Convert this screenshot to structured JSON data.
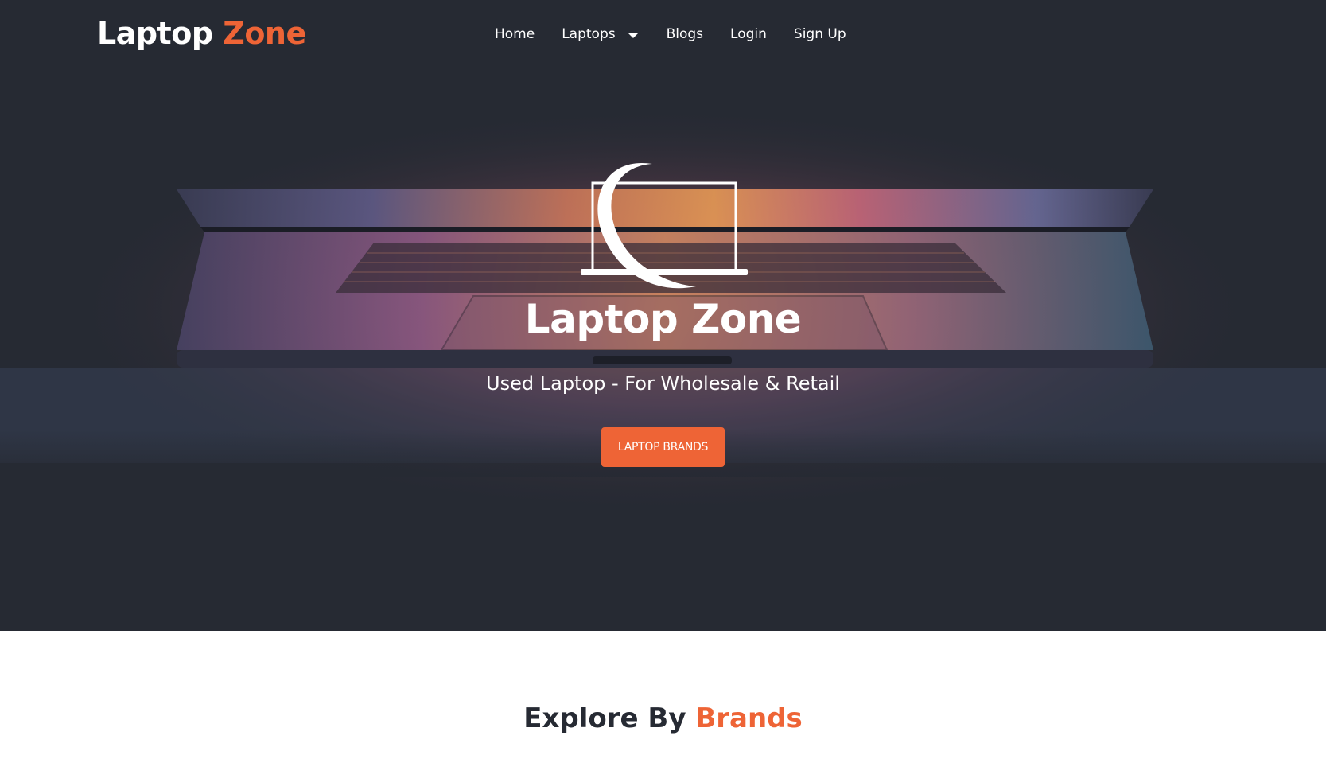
{
  "navbar": {
    "brand_primary": "Laptop",
    "brand_accent": "Zone",
    "links": {
      "home": "Home",
      "laptops": "Laptops",
      "blogs": "Blogs",
      "login": "Login",
      "signup": "Sign Up"
    },
    "laptops_dropdown_icon": "caret-down-icon"
  },
  "hero": {
    "logo_icon": "laptop-swoosh-icon",
    "title": "Laptop Zone",
    "subtitle": "Used Laptop - For Wholesale & Retail",
    "cta_label": "LAPTOP BRANDS",
    "background": "laptop-photo"
  },
  "explore": {
    "title_primary": "Explore By",
    "title_accent": "Brands"
  },
  "colors": {
    "accent": "#ee6436",
    "dark_bg": "#262a33",
    "text_light": "#ffffff",
    "text_dark": "#262a33"
  }
}
